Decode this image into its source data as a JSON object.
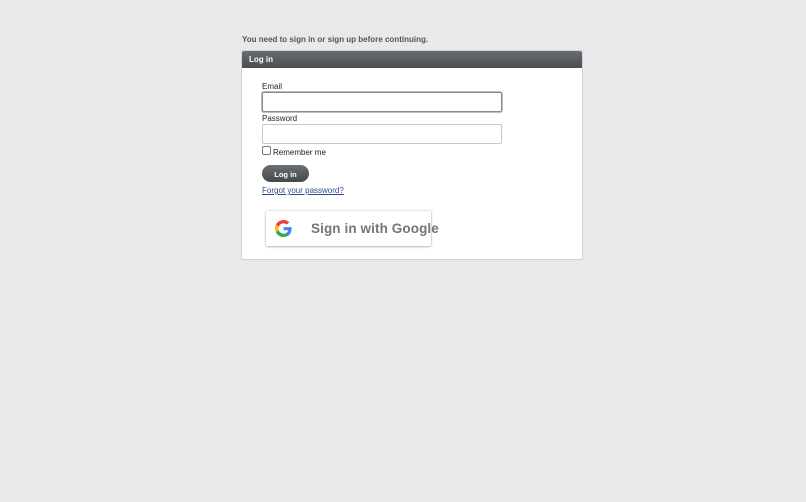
{
  "notice": "You need to sign in or sign up before continuing.",
  "panel": {
    "title": "Log in"
  },
  "form": {
    "email_label": "Email",
    "email_value": "",
    "password_label": "Password",
    "password_value": "",
    "remember_label": "Remember me",
    "remember_checked": false,
    "submit_label": "Log in",
    "forgot_link": "Forgot your password?"
  },
  "google": {
    "label": "Sign in with Google",
    "icon": "google-g-icon"
  },
  "colors": {
    "background": "#e8e9ea",
    "header": "#55585b",
    "link": "#2a4a8a"
  }
}
